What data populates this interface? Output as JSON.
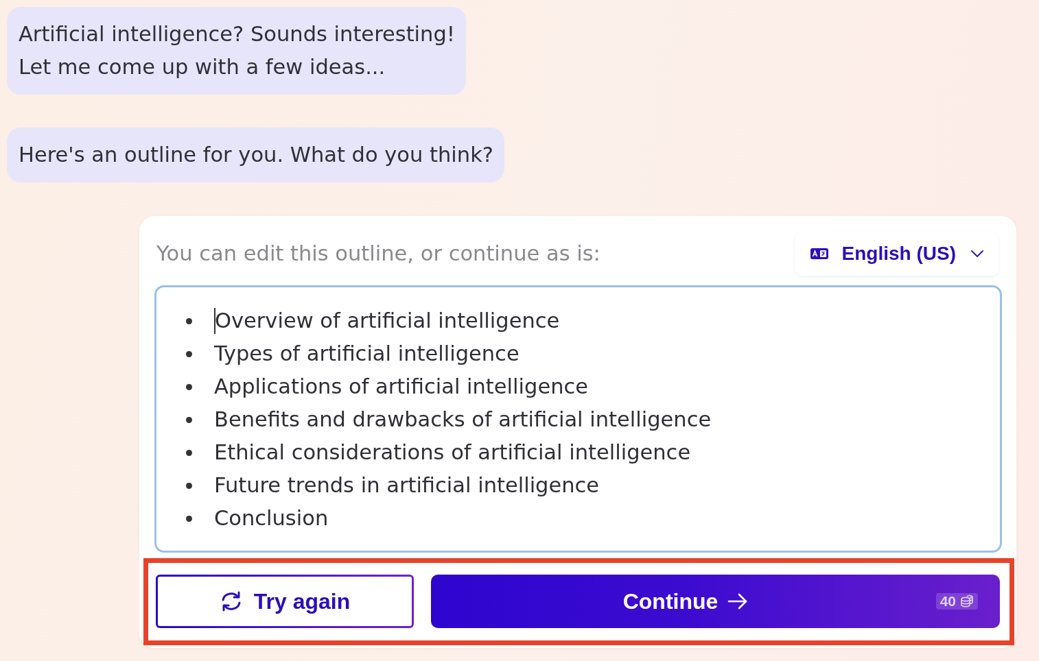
{
  "messages": [
    {
      "text": "Artificial intelligence? Sounds interesting!\nLet me come up with a few ideas..."
    },
    {
      "text": "Here's an outline for you. What do you think?"
    }
  ],
  "outline_panel": {
    "prompt": "You can edit this outline, or continue as is:",
    "language": {
      "label": "English (US)"
    },
    "editor": {
      "focused": true,
      "items": [
        "Overview of artificial intelligence",
        "Types of artificial intelligence",
        "Applications of artificial intelligence",
        "Benefits and drawbacks of artificial intelligence",
        "Ethical considerations of artificial intelligence",
        "Future trends in artificial intelligence",
        "Conclusion"
      ]
    },
    "actions": {
      "highlighted": true,
      "buttons": [
        {
          "kind": "secondary",
          "label": "Try again"
        },
        {
          "kind": "primary",
          "label": "Continue",
          "badge": "40"
        }
      ]
    }
  }
}
